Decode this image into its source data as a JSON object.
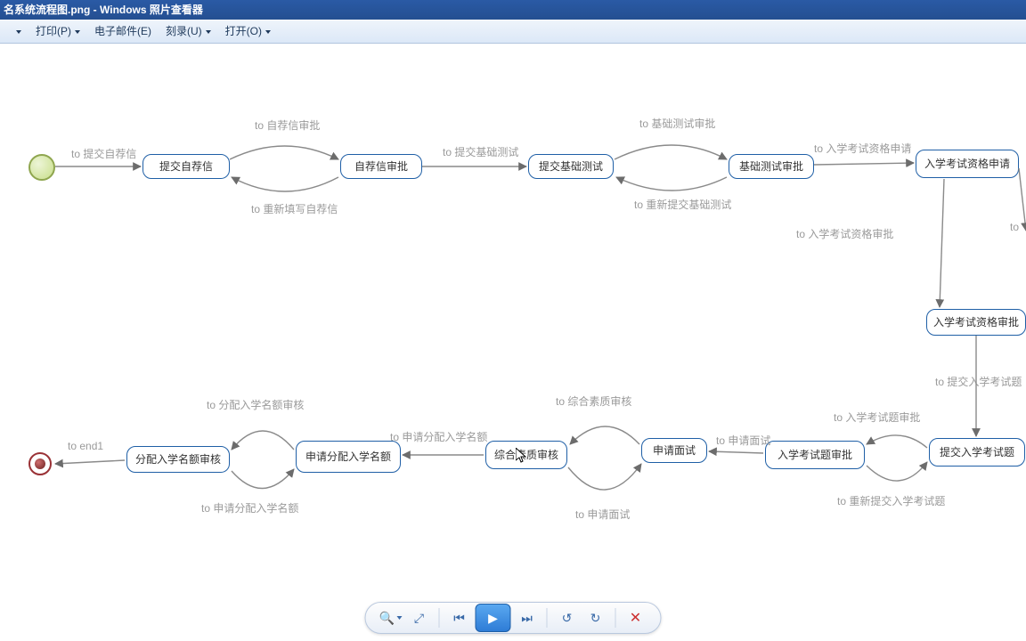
{
  "window": {
    "title_file": "名系统流程图.png",
    "title_app": "Windows 照片查看器"
  },
  "menu": {
    "first_suffix": "▼",
    "print": "打印(P)",
    "email": "电子邮件(E)",
    "burn": "刻录(U)",
    "open": "打开(O)"
  },
  "nodes": {
    "submit_rec": "提交自荐信",
    "rec_approve": "自荐信审批",
    "submit_basic": "提交基础测试",
    "basic_approve": "基础测试审批",
    "exam_qual_apply": "入学考试资格申请",
    "exam_qual_approve": "入学考试资格审批",
    "submit_exam": "提交入学考试题",
    "exam_approve": "入学考试题审批",
    "apply_interview": "申请面试",
    "quality_review": "综合素质审核",
    "apply_quota": "申请分配入学名额",
    "quota_review": "分配入学名额审核"
  },
  "edges": {
    "e_submit_rec": "to 提交自荐信",
    "e_rec_approve": "to 自荐信审批",
    "e_rerec": "to 重新填写自荐信",
    "e_submit_basic": "to 提交基础测试",
    "e_basic_approve": "to 基础测试审批",
    "e_rebasic": "to 重新提交基础测试",
    "e_exam_qual_apply": "to 入学考试资格申请",
    "e_exam_qual_approve": "to 入学考试资格审批",
    "e_to_right": "to",
    "e_submit_exam": "to 提交入学考试题",
    "e_exam_approve": "to 入学考试题审批",
    "e_reexam": "to 重新提交入学考试题",
    "e_apply_interview": "to 申请面试",
    "e_apply_interview2": "to 申请面试",
    "e_quality_review": "to 综合素质审核",
    "e_apply_quota": "to 申请分配入学名额",
    "e_apply_quota2": "to 申请分配入学名额",
    "e_quota_review": "to 分配入学名额审核",
    "e_end": "to end1"
  }
}
